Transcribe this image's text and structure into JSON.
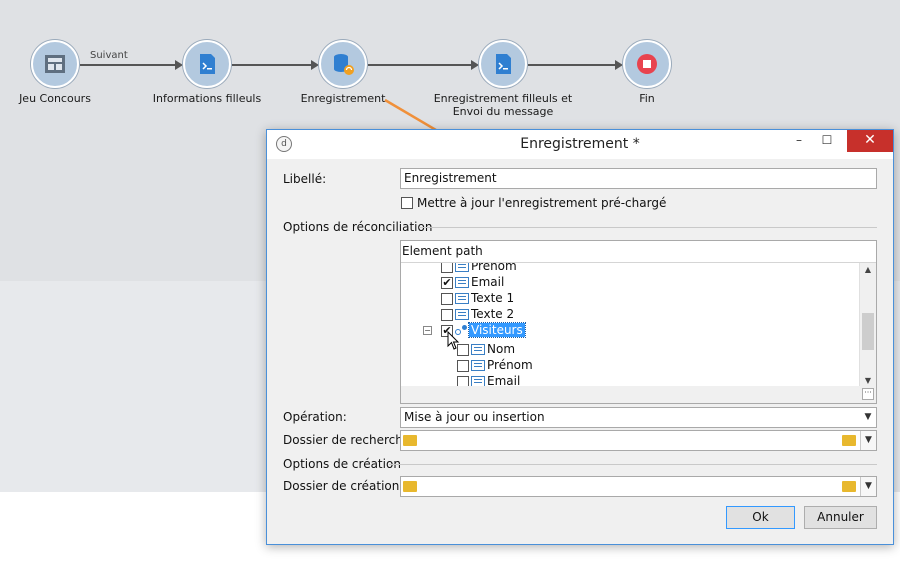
{
  "workflow": {
    "nodes": [
      {
        "label": "Jeu Concours",
        "icon": "form-icon"
      },
      {
        "label": "Informations filleuls",
        "icon": "script-file-icon"
      },
      {
        "label": "Enregistrement",
        "icon": "database-sync-icon"
      },
      {
        "label": "Enregistrement filleuls et Envoi du message",
        "icon": "script-file-icon"
      },
      {
        "label": "Fin",
        "icon": "stop-icon"
      }
    ],
    "transition_label": "Suivant",
    "annotation_arrow_color": "#f0903a"
  },
  "dialog": {
    "title": "Enregistrement *",
    "close_symbol": "✕",
    "maximize_symbol": "☐",
    "minimize_symbol": "–",
    "libelle_label": "Libellé:",
    "libelle_value": "Enregistrement",
    "update_preloaded_label": "Mettre à jour l'enregistrement pré-chargé",
    "reconciliation_section": "Options de réconciliation",
    "tree_header": "Element path",
    "tree_items": [
      {
        "label": "Prénom",
        "checked": false
      },
      {
        "label": "Email",
        "checked": true
      },
      {
        "label": "Texte 1",
        "checked": false
      },
      {
        "label": "Texte 2",
        "checked": false
      },
      {
        "label": "Visiteurs",
        "checked": true,
        "selected": true
      },
      {
        "label": "Nom",
        "checked": false
      },
      {
        "label": "Prénom",
        "checked": false
      },
      {
        "label": "Email",
        "checked": false
      }
    ],
    "operation_label": "Opération:",
    "operation_value": "Mise à jour ou insertion",
    "search_folder_label": "Dossier de recherche:",
    "creation_section": "Options de création",
    "creation_folder_label": "Dossier de création:",
    "ok_label": "Ok",
    "cancel_label": "Annuler",
    "accent_color": "#3399ff",
    "close_color": "#c7302b"
  }
}
